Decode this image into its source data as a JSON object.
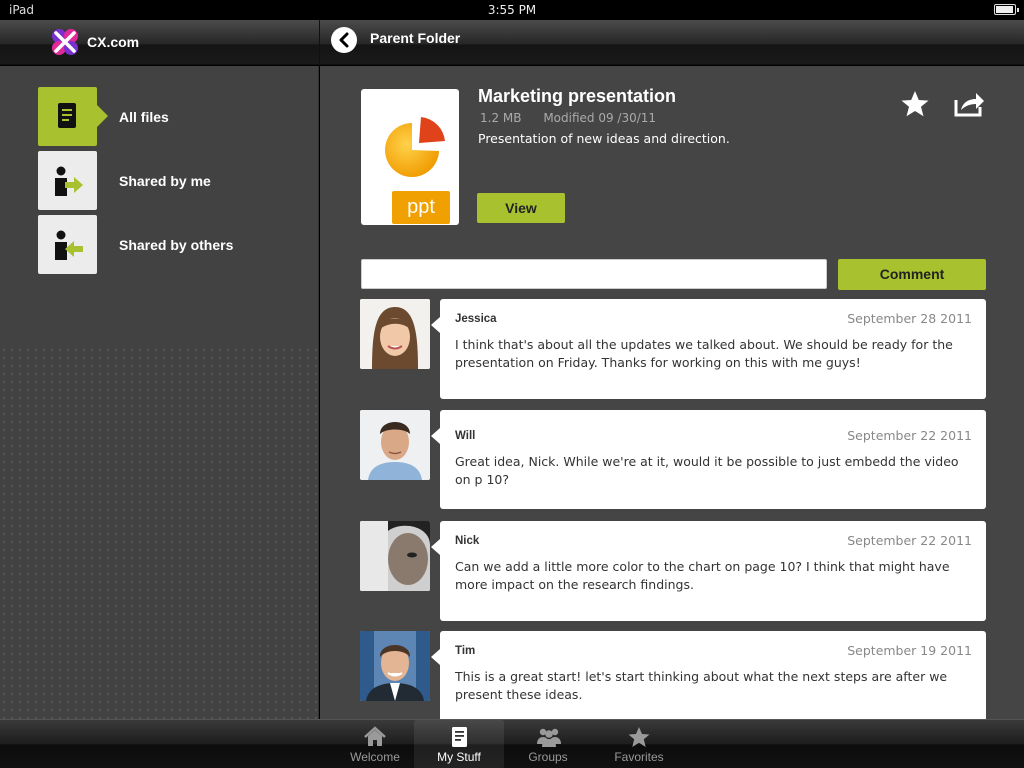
{
  "status_bar": {
    "device": "iPad",
    "time": "3:55 PM"
  },
  "header": {
    "brand": "CX.com",
    "title": "Parent Folder"
  },
  "sidebar": {
    "items": [
      {
        "label": "All files",
        "icon": "document-icon",
        "active": true
      },
      {
        "label": "Shared by me",
        "icon": "person-arrow-out-icon",
        "active": false
      },
      {
        "label": "Shared by others",
        "icon": "person-arrow-in-icon",
        "active": false
      }
    ]
  },
  "file": {
    "title": "Marketing presentation",
    "size": "1.2 MB",
    "modified": "Modified 09 /30/11",
    "description": "Presentation of new ideas and direction.",
    "thumbnail_label": "ppt",
    "view_label": "View"
  },
  "comment_form": {
    "input_value": "",
    "button_label": "Comment"
  },
  "comments": [
    {
      "author": "Jessica",
      "date": "September 28 2011",
      "text": "I think that's about all the updates we talked about. We should be ready for the presentation on Friday. Thanks for working on this with me guys!"
    },
    {
      "author": "Will",
      "date": "September 22 2011",
      "text": "Great idea, Nick. While we're at it, would it be possible to just embedd the video on p 10?"
    },
    {
      "author": "Nick",
      "date": "September 22 2011",
      "text": "Can we add a little more color to the chart on page 10? I think that might have more impact on the research findings."
    },
    {
      "author": "Tim",
      "date": "September 19 2011",
      "text": "This is a great start!  let's start thinking about what the next steps are after we present these ideas."
    }
  ],
  "tabbar": {
    "tabs": [
      {
        "label": "Welcome",
        "icon": "home-icon",
        "active": false
      },
      {
        "label": "My Stuff",
        "icon": "document-icon",
        "active": true
      },
      {
        "label": "Groups",
        "icon": "people-icon",
        "active": false
      },
      {
        "label": "Favorites",
        "icon": "star-icon",
        "active": false
      }
    ]
  },
  "colors": {
    "accent": "#a8c22f",
    "ppt_orange": "#f0a000",
    "panel": "#454545",
    "sidebar": "#424242"
  }
}
